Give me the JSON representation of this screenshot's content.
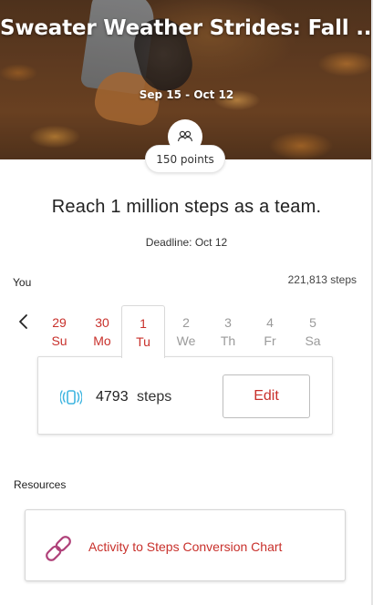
{
  "hero": {
    "title": "Sweater Weather Strides: Fall ...",
    "dates": "Sep 15 - Oct 12"
  },
  "points": {
    "label": "150 points",
    "icon": "team-icon"
  },
  "challenge": {
    "goal": "Reach 1 million steps as a team.",
    "deadline": "Deadline: Oct 12"
  },
  "you": {
    "label": "You",
    "total_steps": "221,813 steps"
  },
  "days": [
    {
      "num": "29",
      "dow": "Su",
      "state": "past"
    },
    {
      "num": "30",
      "dow": "Mo",
      "state": "past"
    },
    {
      "num": "1",
      "dow": "Tu",
      "state": "selected"
    },
    {
      "num": "2",
      "dow": "We",
      "state": "future"
    },
    {
      "num": "3",
      "dow": "Th",
      "state": "future"
    },
    {
      "num": "4",
      "dow": "Fr",
      "state": "future"
    },
    {
      "num": "5",
      "dow": "Sa",
      "state": "future"
    }
  ],
  "day_entry": {
    "steps_value": "4793",
    "steps_unit": "steps",
    "edit_label": "Edit",
    "icon": "activity-tracker-icon"
  },
  "resources": {
    "label": "Resources",
    "items": [
      {
        "title": "Activity to Steps Conversion Chart",
        "icon": "link-icon"
      }
    ]
  },
  "colors": {
    "accent": "#c8302b",
    "muted": "#9a9a9a",
    "tracker": "#3fb5e0",
    "link_icon": "#b0427a"
  }
}
